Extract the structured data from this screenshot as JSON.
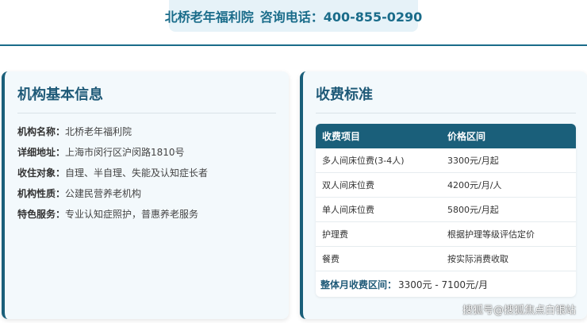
{
  "header": {
    "institution": "北桥老年福利院",
    "phone_label": "咨询电话：400-855-0290"
  },
  "basic_info": {
    "title": "机构基本信息",
    "rows": [
      {
        "label": "机构名称：",
        "value": "北桥老年福利院"
      },
      {
        "label": "详细地址：",
        "value": "上海市闵行区沪闵路1810号"
      },
      {
        "label": "收住对象：",
        "value": "自理、半自理、失能及认知症长者"
      },
      {
        "label": "机构性质：",
        "value": "公建民营养老机构"
      },
      {
        "label": "特色服务：",
        "value": "专业认知症照护，普惠养老服务"
      }
    ]
  },
  "fees": {
    "title": "收费标准",
    "columns": [
      "收费项目",
      "价格区间"
    ],
    "rows": [
      {
        "item": "多人间床位费(3-4人)",
        "price": "3300元/月起"
      },
      {
        "item": "双人间床位费",
        "price": "4200元/月/人"
      },
      {
        "item": "单人间床位费",
        "price": "5800元/月起"
      },
      {
        "item": "护理费",
        "price": "根据护理等级评估定价"
      },
      {
        "item": "餐费",
        "price": "按实际消费收取"
      }
    ],
    "summary_label": "整体月收费区间：",
    "summary_value": "3300元 - 7100元/月"
  },
  "watermark": "搜狐号@搜狐焦点白银站",
  "colors": {
    "accent": "#1a5f7a",
    "header_text": "#1a6c8a",
    "card_bg": "#f3f9fc",
    "header_bg": "#e6f2f8"
  }
}
